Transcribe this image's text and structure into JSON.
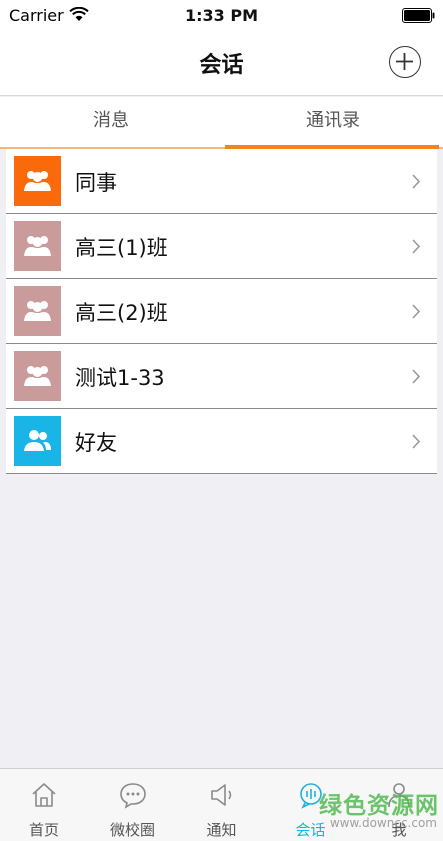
{
  "status_bar": {
    "carrier": "Carrier",
    "time": "1:33 PM"
  },
  "nav": {
    "title": "会话"
  },
  "tabs": [
    {
      "label": "消息",
      "active": false
    },
    {
      "label": "通讯录",
      "active": true
    }
  ],
  "contacts": [
    {
      "label": "同事",
      "avatar_color": "#fa6a0b"
    },
    {
      "label": "高三(1)班",
      "avatar_color": "#c99b9b"
    },
    {
      "label": "高三(2)班",
      "avatar_color": "#c99b9b"
    },
    {
      "label": "测试1-33",
      "avatar_color": "#c99b9b"
    },
    {
      "label": "好友",
      "avatar_color": "#18b5e6"
    }
  ],
  "bottom_nav": [
    {
      "label": "首页",
      "icon": "home-icon",
      "active": false
    },
    {
      "label": "微校圈",
      "icon": "chat-bubble-icon",
      "active": false
    },
    {
      "label": "通知",
      "icon": "speaker-icon",
      "active": false
    },
    {
      "label": "会话",
      "icon": "conversation-icon",
      "active": true
    },
    {
      "label": "我",
      "icon": "profile-icon",
      "active": false
    }
  ],
  "watermark": {
    "title": "绿色资源网",
    "url": "www.downcc.com"
  },
  "colors": {
    "accent": "#f08522",
    "active_tab": "#1cb3dc"
  }
}
